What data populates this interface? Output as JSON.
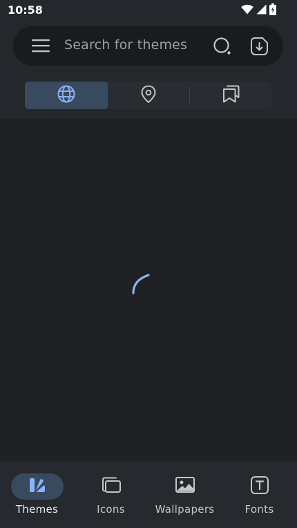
{
  "status_bar": {
    "time": "10:58",
    "icons": [
      "wifi-icon",
      "cell-signal-icon",
      "battery-icon"
    ]
  },
  "search": {
    "placeholder": "Search for themes",
    "menu_icon": "hamburger-menu-icon",
    "search_icon": "search-icon",
    "import_icon": "import-file-icon"
  },
  "segments": [
    {
      "name": "global",
      "icon": "globe-icon",
      "selected": true
    },
    {
      "name": "local",
      "icon": "location-pin-icon",
      "selected": false
    },
    {
      "name": "saved",
      "icon": "bookmarks-icon",
      "selected": false
    }
  ],
  "loading": {
    "icon": "loading-spinner"
  },
  "bottom_nav": {
    "items": [
      {
        "label": "Themes",
        "icon": "themes-icon",
        "active": true
      },
      {
        "label": "Icons",
        "icon": "icons-icon",
        "active": false
      },
      {
        "label": "Wallpapers",
        "icon": "wallpapers-icon",
        "active": false
      },
      {
        "label": "Fonts",
        "icon": "fonts-icon",
        "active": false
      }
    ]
  },
  "colors": {
    "background": "#202124",
    "top_area": "#24272b",
    "search_bar": "#191b1e",
    "accent": "#8ab4f8",
    "selected_segment": "#3a4a5e",
    "nav_bar": "#26292e"
  }
}
